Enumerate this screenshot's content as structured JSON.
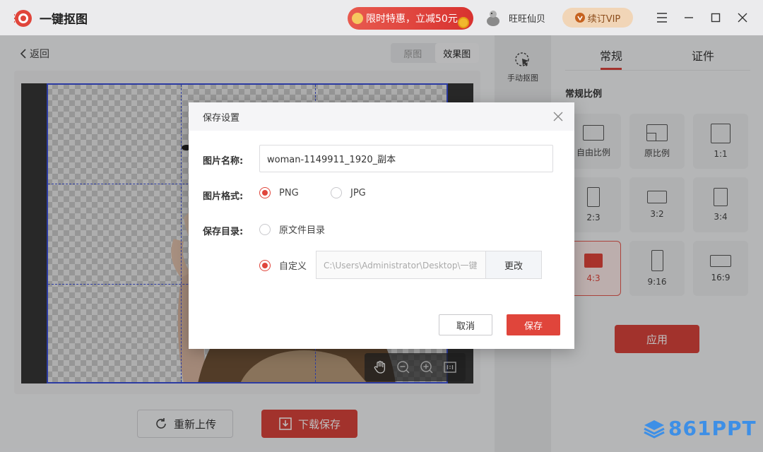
{
  "app": {
    "title": "一键抠图",
    "logo_icon": "eye-logo-icon"
  },
  "header": {
    "promo": "限时特惠，立减50元",
    "username": "旺旺仙贝",
    "vip": "续订VIP",
    "window_controls": [
      "menu-icon",
      "minimize-icon",
      "maximize-icon",
      "close-icon"
    ]
  },
  "workspace": {
    "back": "返回",
    "view_tabs": [
      {
        "label": "原图",
        "active": false
      },
      {
        "label": "效果图",
        "active": true
      }
    ],
    "reupload": "重新上传",
    "download": "下载保存",
    "canvas_tools": [
      "hand-icon",
      "zoom-out-icon",
      "zoom-in-icon",
      "actual-size-icon"
    ]
  },
  "manual": {
    "label": "手动抠图"
  },
  "right_panel": {
    "tabs": [
      {
        "label": "常规",
        "active": true
      },
      {
        "label": "证件",
        "active": false
      }
    ],
    "section_title": "常规比例",
    "ratios": [
      {
        "label": "自由比例",
        "active": false
      },
      {
        "label": "原比例",
        "active": false
      },
      {
        "label": "1:1",
        "active": false
      },
      {
        "label": "2:3",
        "active": false
      },
      {
        "label": "3:2",
        "active": false
      },
      {
        "label": "3:4",
        "active": false
      },
      {
        "label": "4:3",
        "active": true
      },
      {
        "label": "9:16",
        "active": false
      },
      {
        "label": "16:9",
        "active": false
      }
    ],
    "apply": "应用"
  },
  "dialog": {
    "title": "保存设置",
    "name_label": "图片名称:",
    "name_value": "woman-1149911_1920_副本",
    "format_label": "图片格式:",
    "formats": [
      {
        "label": "PNG",
        "checked": true
      },
      {
        "label": "JPG",
        "checked": false
      }
    ],
    "dir_label": "保存目录:",
    "dir_options": [
      {
        "label": "原文件目录",
        "checked": false
      },
      {
        "label": "自定义",
        "checked": true
      }
    ],
    "path_value": "C:\\Users\\Administrator\\Desktop\\一键",
    "change": "更改",
    "cancel": "取消",
    "save": "保存"
  },
  "watermark": "861PPT",
  "colors": {
    "accent": "#d9433b",
    "crop": "#3b4fd8",
    "watermark": "#3d8fe6"
  }
}
